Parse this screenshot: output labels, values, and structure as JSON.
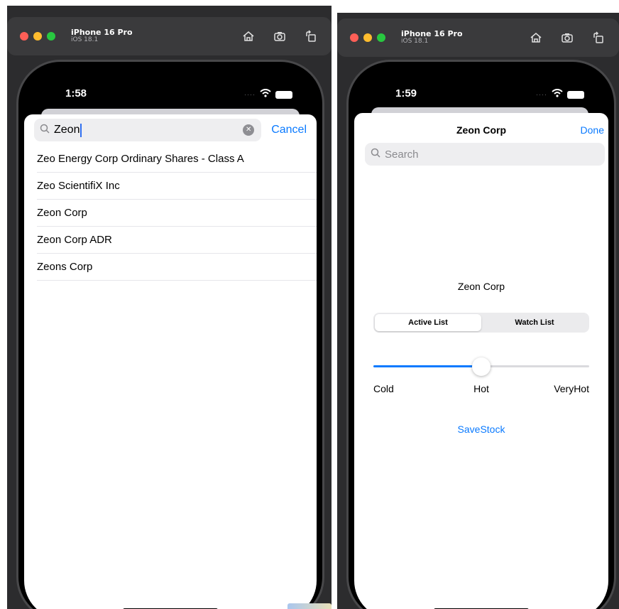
{
  "left": {
    "titlebar": {
      "device_name": "iPhone 16 Pro",
      "os": "iOS 18.1"
    },
    "status": {
      "time": "1:58"
    },
    "search": {
      "query": "Zeon",
      "cancel_label": "Cancel"
    },
    "results": [
      "Zeo Energy Corp Ordinary Shares - Class A",
      "Zeo ScientifiX Inc",
      "Zeon Corp",
      "Zeon Corp ADR",
      "Zeons Corp"
    ]
  },
  "right": {
    "titlebar": {
      "device_name": "iPhone 16 Pro",
      "os": "iOS 18.1"
    },
    "status": {
      "time": "1:59"
    },
    "nav": {
      "title": "Zeon Corp",
      "done_label": "Done"
    },
    "search": {
      "placeholder": "Search"
    },
    "stock_label": "Zeon Corp",
    "segmented": {
      "options": [
        "Active List",
        "Watch List"
      ],
      "selected": "Active List"
    },
    "slider": {
      "value": 0.5,
      "labels": [
        "Cold",
        "Hot",
        "VeryHot"
      ]
    },
    "save_label": "SaveStock"
  },
  "colors": {
    "accent": "#0a7aff",
    "close": "#ff5f57",
    "minimize": "#febc2e",
    "zoom": "#28c840"
  }
}
